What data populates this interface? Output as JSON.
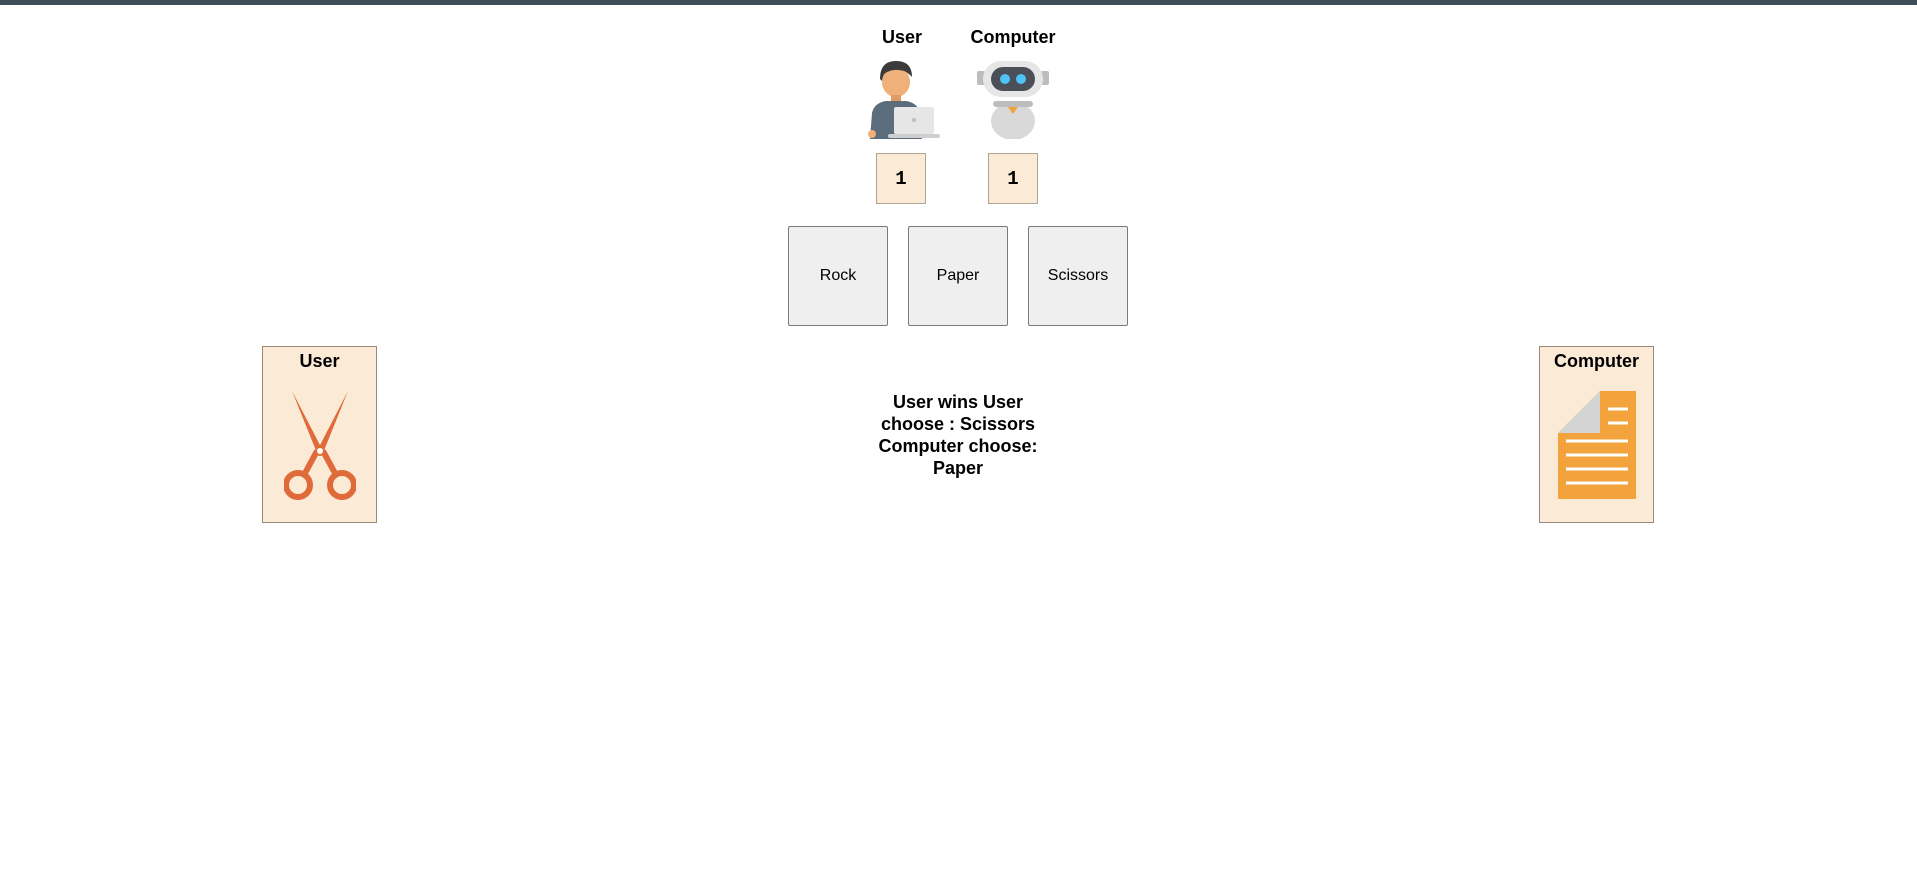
{
  "colors": {
    "topbar": "#3f4c5a",
    "score_bg": "#fbebd6",
    "card_bg": "#fbebd6",
    "button_bg": "#efefef",
    "scissors": "#e06b3a",
    "paper": "#f2a33c"
  },
  "scoreboard": {
    "user": {
      "name": "User",
      "score": "1",
      "icon": "user-laptop-icon"
    },
    "computer": {
      "name": "Computer",
      "score": "1",
      "icon": "robot-icon"
    }
  },
  "choices": [
    "Rock",
    "Paper",
    "Scissors"
  ],
  "cards": {
    "user": {
      "label": "User",
      "choice_icon": "scissors-icon"
    },
    "computer": {
      "label": "Computer",
      "choice_icon": "paper-icon"
    }
  },
  "result": {
    "line1": "User wins User",
    "line2": "choose : Scissors",
    "line3": "Computer choose:",
    "line4": "Paper"
  }
}
